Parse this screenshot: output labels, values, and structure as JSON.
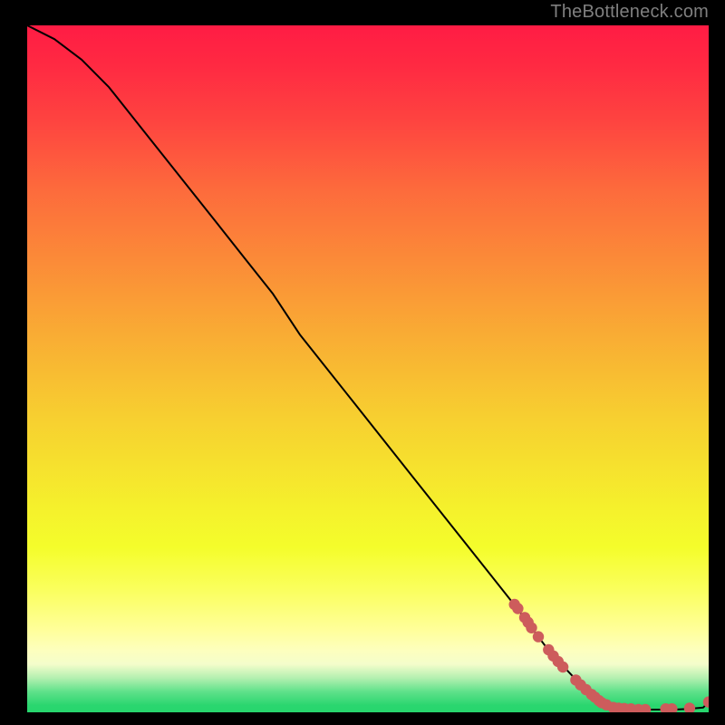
{
  "attribution": "TheBottleneck.com",
  "colors": {
    "dot": "#cd5c5c",
    "line": "#000000",
    "background_top": "#ff1c44",
    "background_bottom": "#27d66e",
    "page_bg": "#000000",
    "attribution_text": "#7f7f7f"
  },
  "chart_data": {
    "type": "line",
    "title": "",
    "xlabel": "",
    "ylabel": "",
    "xlim": [
      0,
      100
    ],
    "ylim": [
      0,
      100
    ],
    "grid": false,
    "legend": false,
    "series": [
      {
        "name": "curve",
        "kind": "line",
        "x": [
          0,
          4,
          8,
          12,
          16,
          20,
          24,
          28,
          32,
          36,
          40,
          44,
          48,
          52,
          56,
          60,
          64,
          68,
          72,
          74,
          76,
          78,
          80,
          82,
          83,
          84,
          85,
          86,
          89,
          92,
          95,
          97,
          99.2,
          100
        ],
        "y": [
          100,
          98,
          95,
          91,
          86,
          81,
          76,
          71,
          66,
          61,
          55,
          50,
          45,
          40,
          35,
          30,
          25,
          20,
          15,
          12.3,
          9.7,
          7.4,
          5.3,
          3.3,
          2.4,
          1.7,
          1.1,
          0.7,
          0.4,
          0.4,
          0.4,
          0.5,
          0.7,
          1.5
        ]
      },
      {
        "name": "dots-descent",
        "kind": "scatter",
        "x": [
          71.5,
          72.0,
          73.0,
          73.5,
          74.0,
          75.0,
          76.5,
          77.2,
          77.9,
          78.6,
          80.5,
          81.2,
          82.0,
          82.8,
          83.3,
          83.9,
          84.3,
          85.0,
          86.0
        ],
        "y": [
          15.7,
          15.1,
          13.8,
          13.1,
          12.3,
          11.0,
          9.1,
          8.2,
          7.4,
          6.6,
          4.7,
          4.0,
          3.3,
          2.6,
          2.2,
          1.7,
          1.4,
          1.1,
          0.7
        ]
      },
      {
        "name": "dots-floor",
        "kind": "scatter",
        "x": [
          86.0,
          86.8,
          87.6,
          88.6,
          89.7,
          90.7,
          93.7,
          94.6,
          97.2,
          100.0
        ],
        "y": [
          0.7,
          0.6,
          0.55,
          0.5,
          0.4,
          0.4,
          0.5,
          0.5,
          0.6,
          1.5
        ]
      }
    ]
  }
}
